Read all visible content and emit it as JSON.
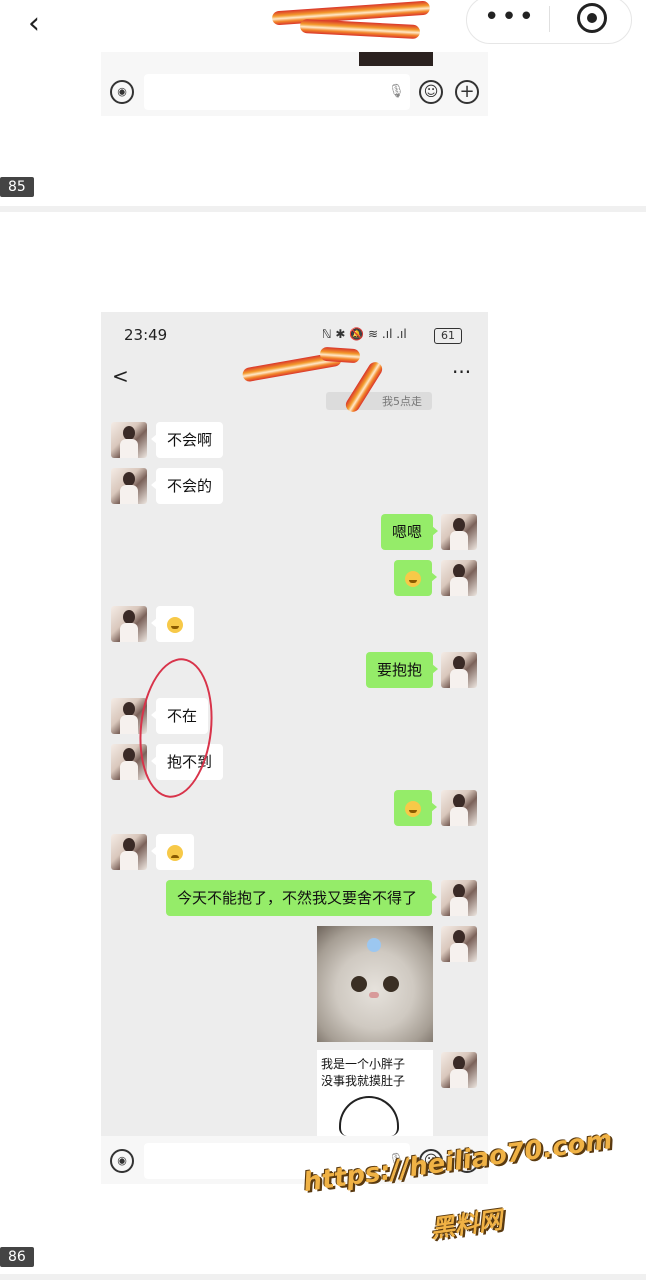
{
  "app_bar": {
    "back_icon": "chevron-left-icon",
    "more_icon": "more-dots-icon",
    "close_icon": "target-close-icon",
    "more_glyph": "•••"
  },
  "prev_page_fragment": {
    "voice_icon": "voice-icon",
    "mic_icon": "mic-icon",
    "emoji_icon": "emoji-icon",
    "plus_icon": "plus-icon",
    "page_number": "85"
  },
  "chat_screenshot": {
    "status_bar": {
      "time": "23:49",
      "icons": "ℕ ✱ 🔕 ≋ .ıl .ıl",
      "battery": "61"
    },
    "header": {
      "back_glyph": "<",
      "more_glyph": "···"
    },
    "notice": "我5点走",
    "messages": [
      {
        "side": "in",
        "text": "不会啊"
      },
      {
        "side": "in",
        "text": "不会的"
      },
      {
        "side": "out",
        "text": "嗯嗯"
      },
      {
        "side": "out",
        "emoji": "smile"
      },
      {
        "side": "in",
        "emoji": "smile"
      },
      {
        "side": "out",
        "text": "要抱抱"
      },
      {
        "side": "in",
        "text": "不在"
      },
      {
        "side": "in",
        "text": "抱不到"
      },
      {
        "side": "out",
        "emoji": "smile"
      },
      {
        "side": "in",
        "emoji": "sad"
      },
      {
        "side": "out",
        "text": "今天不能抱了，不然我又要舍不得了"
      },
      {
        "side": "out",
        "sticker": "cat"
      },
      {
        "side": "out",
        "sticker": "text"
      }
    ],
    "sticker_caption": "我是一个小胖子\n没事我就摸肚子",
    "page_number": "86"
  },
  "watermark": {
    "url": "https://heiliao70.com",
    "name": "黑料网"
  },
  "colors": {
    "chat_bg": "#ededed",
    "out_bubble": "#95ec69",
    "in_bubble": "#ffffff",
    "annotation_red": "#d8334a",
    "watermark": "#f0b245"
  }
}
